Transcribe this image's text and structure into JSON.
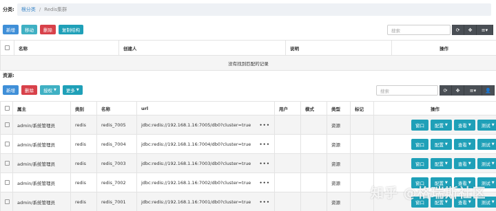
{
  "breadcrumb": {
    "label": "分类:",
    "items": [
      "根分类",
      "Redis集群"
    ]
  },
  "category_toolbar": {
    "buttons": [
      "新增",
      "移动",
      "删除",
      "复制结构"
    ],
    "search_placeholder": "搜索"
  },
  "category_table": {
    "columns": [
      "名称",
      "创建人",
      "说明",
      "操作"
    ],
    "empty_text": "没有找到匹配的记录"
  },
  "resources_label": "资源:",
  "resource_toolbar": {
    "buttons": [
      "新增",
      "删除",
      "授权",
      "更多"
    ],
    "search_placeholder": "搜索"
  },
  "resource_table": {
    "columns": [
      "属主",
      "类别",
      "名称",
      "url",
      "用户",
      "模式",
      "类型",
      "标记",
      "操作"
    ],
    "rows": [
      {
        "owner": "admin/系统管理员",
        "category": "redis",
        "name": "redis_7005",
        "url": "jdbc:redis://192.168.1.16:7005/db0?cluster=true",
        "more": "•••",
        "type": "资源"
      },
      {
        "owner": "admin/系统管理员",
        "category": "redis",
        "name": "redis_7004",
        "url": "jdbc:redis://192.168.1.16:7004/db0?cluster=true",
        "more": "•••",
        "type": "资源"
      },
      {
        "owner": "admin/系统管理员",
        "category": "redis",
        "name": "redis_7003",
        "url": "jdbc:redis://192.168.1.16:7003/db0?cluster=true",
        "more": "•••",
        "type": "资源"
      },
      {
        "owner": "admin/系统管理员",
        "category": "redis",
        "name": "redis_7002",
        "url": "jdbc:redis://192.168.1.16:7002/db0?cluster=true",
        "more": "•••",
        "type": "资源"
      },
      {
        "owner": "admin/系统管理员",
        "category": "redis",
        "name": "redis_7001",
        "url": "jdbc:redis://192.168.1.16:7001/db0?cluster=true",
        "more": "•••",
        "type": "资源"
      }
    ],
    "row_actions": [
      "窗口",
      "配置",
      "查看",
      "测试"
    ]
  },
  "watermark": "知乎 @格瑞斯社区",
  "colors": {
    "primary": "#3f8fd8",
    "teal": "#3fb0c3",
    "danger": "#d8414a",
    "cyan": "#1fa0b8",
    "tool": "#4a4f55"
  },
  "icons": {
    "refresh": "refresh-icon",
    "expand": "move-icon",
    "columns": "list-icon",
    "user": "user-icon"
  }
}
